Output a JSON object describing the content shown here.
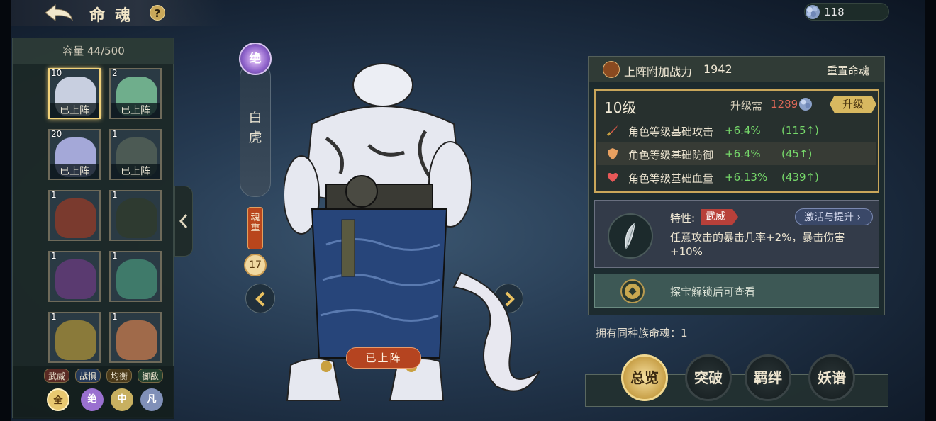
{
  "header": {
    "title": "命魂",
    "help": "?"
  },
  "currency": {
    "gem_count": "118"
  },
  "inventory": {
    "capacity": "容量 44/500",
    "cards": [
      {
        "level": "10",
        "tag": "已上阵",
        "selected": true,
        "art": "#c8cfe0"
      },
      {
        "level": "2",
        "tag": "已上阵",
        "selected": false,
        "art": "#6fae8c"
      },
      {
        "level": "20",
        "tag": "已上阵",
        "selected": false,
        "art": "#a4a8d8"
      },
      {
        "level": "1",
        "tag": "已上阵",
        "selected": false,
        "art": "#4c5a54"
      },
      {
        "level": "1",
        "tag": "",
        "selected": false,
        "art": "#7a3a2e"
      },
      {
        "level": "1",
        "tag": "",
        "selected": false,
        "art": "#2e3a30"
      },
      {
        "level": "1",
        "tag": "",
        "selected": false,
        "art": "#5a3a70"
      },
      {
        "level": "1",
        "tag": "",
        "selected": false,
        "art": "#3f7a6a"
      },
      {
        "level": "1",
        "tag": "",
        "selected": false,
        "art": "#8a7a3a"
      },
      {
        "level": "1",
        "tag": "",
        "selected": false,
        "art": "#a06a4a"
      }
    ],
    "filters": [
      "武威",
      "战惧",
      "均衡",
      "御敌"
    ],
    "grades": [
      "全",
      "绝",
      "中",
      "凡"
    ]
  },
  "soul": {
    "grade": "绝",
    "name": "白虎",
    "weight_label": "魂重",
    "weight_value": "17",
    "deployed_badge": "已上阵"
  },
  "detail": {
    "power_label": "上阵附加战力",
    "power_value": "1942",
    "reset_label": "重置命魂",
    "level": "10级",
    "upgrade_need_label": "升级需",
    "upgrade_cost": "1289",
    "upgrade_button": "升级",
    "stats": [
      {
        "label": "角色等级基础攻击",
        "pct": "+6.4%",
        "abs": "(115↑)",
        "icon": "sword-icon",
        "color": "#e05a48"
      },
      {
        "label": "角色等级基础防御",
        "pct": "+6.4%",
        "abs": "(45↑)",
        "icon": "shield-icon",
        "color": "#e8a060"
      },
      {
        "label": "角色等级基础血量",
        "pct": "+6.13%",
        "abs": "(439↑)",
        "icon": "heart-icon",
        "color": "#e85858"
      }
    ],
    "trait": {
      "label": "特性:",
      "value": "武威",
      "activate_label": "激活与提升",
      "description": "任意攻击的暴击几率+2%，暴击伤害+10%"
    },
    "locked_text": "探宝解锁后可查看",
    "same_race": "拥有同种族命魂：1"
  },
  "tabs": [
    {
      "label": "总览",
      "active": true
    },
    {
      "label": "突破",
      "active": false
    },
    {
      "label": "羁绊",
      "active": false
    },
    {
      "label": "妖谱",
      "active": false
    }
  ]
}
